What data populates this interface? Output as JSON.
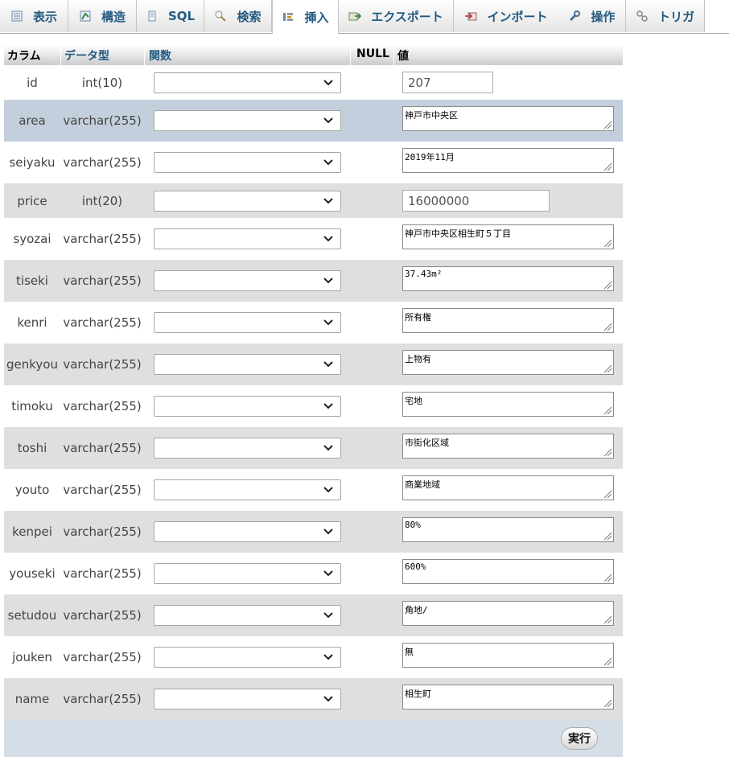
{
  "tabs": [
    {
      "label": "表示",
      "icon": "browse-table-icon",
      "active": false
    },
    {
      "label": "構造",
      "icon": "structure-icon",
      "active": false
    },
    {
      "label": "SQL",
      "icon": "sql-icon",
      "active": false
    },
    {
      "label": "検索",
      "icon": "search-icon",
      "active": false
    },
    {
      "label": "挿入",
      "icon": "insert-row-icon",
      "active": true
    },
    {
      "label": "エクスポート",
      "icon": "export-icon",
      "active": false
    },
    {
      "label": "インポート",
      "icon": "import-icon",
      "active": false
    },
    {
      "label": "操作",
      "icon": "wrench-icon",
      "active": false
    },
    {
      "label": "トリガ",
      "icon": "trigger-icon",
      "active": false
    }
  ],
  "table_header": {
    "column": "カラム",
    "type": "データ型",
    "function": "関数",
    "null": "NULL",
    "value": "値"
  },
  "rows": [
    {
      "name": "id",
      "type": "int(10)",
      "value": "207",
      "kind": "input"
    },
    {
      "name": "area",
      "type": "varchar(255)",
      "value": "神戸市中央区",
      "kind": "textarea"
    },
    {
      "name": "seiyaku",
      "type": "varchar(255)",
      "value": "2019年11月",
      "kind": "textarea"
    },
    {
      "name": "price",
      "type": "int(20)",
      "value": "16000000",
      "kind": "input"
    },
    {
      "name": "syozai",
      "type": "varchar(255)",
      "value": "神戸市中央区相生町５丁目",
      "kind": "textarea"
    },
    {
      "name": "tiseki",
      "type": "varchar(255)",
      "value": "37.43m²",
      "kind": "textarea"
    },
    {
      "name": "kenri",
      "type": "varchar(255)",
      "value": "所有権",
      "kind": "textarea"
    },
    {
      "name": "genkyou",
      "type": "varchar(255)",
      "value": "上物有",
      "kind": "textarea"
    },
    {
      "name": "timoku",
      "type": "varchar(255)",
      "value": "宅地",
      "kind": "textarea"
    },
    {
      "name": "toshi",
      "type": "varchar(255)",
      "value": "市街化区域",
      "kind": "textarea"
    },
    {
      "name": "youto",
      "type": "varchar(255)",
      "value": "商業地域",
      "kind": "textarea"
    },
    {
      "name": "kenpei",
      "type": "varchar(255)",
      "value": "80%",
      "kind": "textarea"
    },
    {
      "name": "youseki",
      "type": "varchar(255)",
      "value": "600%",
      "kind": "textarea"
    },
    {
      "name": "setudou",
      "type": "varchar(255)",
      "value": "角地/",
      "kind": "textarea"
    },
    {
      "name": "jouken",
      "type": "varchar(255)",
      "value": "無",
      "kind": "textarea"
    },
    {
      "name": "name",
      "type": "varchar(255)",
      "value": "相生町",
      "kind": "textarea"
    }
  ],
  "submit_label": "実行",
  "colors": {
    "link": "#235a81",
    "row_alt": "#dfdfdf",
    "row_highlight": "#c3cfdc",
    "footer": "#d5dde6"
  }
}
